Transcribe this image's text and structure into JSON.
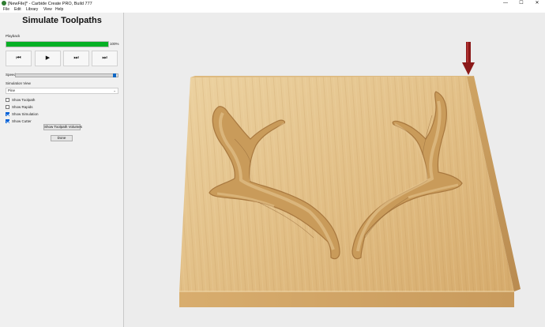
{
  "window": {
    "title": "[NewFile]* - Carbide Create PRO, Build 777",
    "minimize": "—",
    "maximize": "☐",
    "close": "✕"
  },
  "menu": {
    "items": [
      "File",
      "Edit",
      "Library",
      "View",
      "Help"
    ]
  },
  "panel": {
    "title": "Simulate Toolpaths",
    "playback_label": "Playback",
    "progress_value": 100,
    "progress_text": "100%",
    "controls": [
      "⏮",
      "▶",
      "⏭",
      "⏭"
    ],
    "speed_label": "Speed",
    "speed_value": 0.97,
    "simulation_view_label": "Simulation View",
    "simulation_view_value": "Pine",
    "checkboxes": [
      {
        "label": "Show Toolpath",
        "checked": false
      },
      {
        "label": "Show Rapids",
        "checked": false
      },
      {
        "label": "Show Simulation",
        "checked": true
      },
      {
        "label": "Show Cutter",
        "checked": true
      }
    ],
    "volumes_button": "Show Toolpath Volumes",
    "done_button": "Done"
  },
  "colors": {
    "progress": "#06b025",
    "accent": "#0a64d8",
    "wood_light": "#e6c48c",
    "wood_dark": "#c9a068",
    "cutter": "#8b1a1a"
  }
}
